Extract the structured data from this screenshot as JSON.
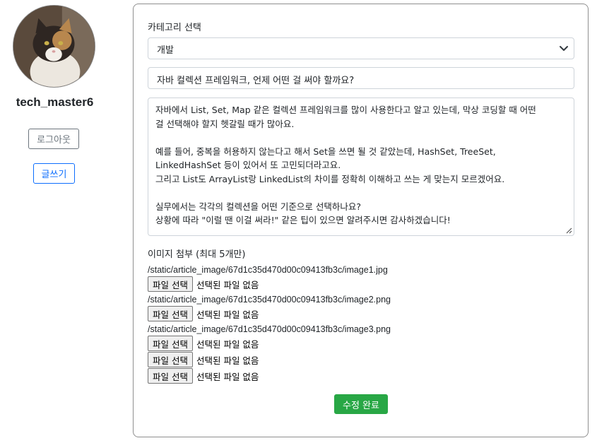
{
  "sidebar": {
    "username": "tech_master6",
    "logout_label": "로그아웃",
    "write_label": "글쓰기"
  },
  "form": {
    "category_label": "카테고리 선택",
    "category_value": "개발",
    "title_value": "자바 컬렉션 프레임워크, 언제 어떤 걸 써야 할까요?",
    "body_lines": [
      "자바에서 List, Set, Map 같은 컬렉션 프레임워크를 많이 사용한다고 알고 있는데, 막상 코딩할 때 어떤",
      "걸 선택해야 할지 헷갈릴 때가 많아요.",
      "",
      "예를 들어, 중복을 허용하지 않는다고 해서 Set을 쓰면 될 것 같았는데, HashSet, TreeSet,",
      "LinkedHashSet 등이 있어서 또 고민되더라고요.",
      "그리고 List도 ArrayList랑 LinkedList의 차이를 정확히 이해하고 쓰는 게 맞는지 모르겠어요.",
      "",
      "실무에서는 각각의 컬렉션을 어떤 기준으로 선택하나요?",
      "상황에 따라 \"이럴 땐 이걸 써라!\" 같은 팁이 있으면 알려주시면 감사하겠습니다!"
    ],
    "image_label": "이미지 첨부 (최대 5개만)",
    "files": [
      {
        "path": "/static/article_image/67d1c35d470d00c09413fb3c/image1.jpg",
        "button": "파일 선택",
        "status": "선택된 파일 없음"
      },
      {
        "path": "/static/article_image/67d1c35d470d00c09413fb3c/image2.png",
        "button": "파일 선택",
        "status": "선택된 파일 없음"
      },
      {
        "path": "/static/article_image/67d1c35d470d00c09413fb3c/image3.png",
        "button": "파일 선택",
        "status": "선택된 파일 없음"
      },
      {
        "path": "",
        "button": "파일 선택",
        "status": "선택된 파일 없음"
      },
      {
        "path": "",
        "button": "파일 선택",
        "status": "선택된 파일 없음"
      }
    ],
    "submit_label": "수정 완료"
  },
  "colors": {
    "primary": "#0d6efd",
    "secondary": "#6c757d",
    "success": "#28a745"
  }
}
